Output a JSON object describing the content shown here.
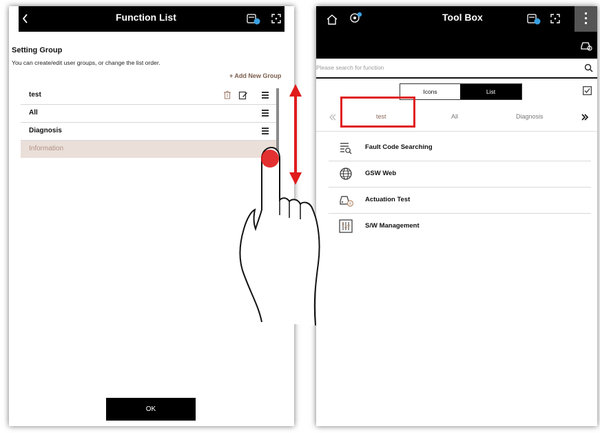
{
  "left": {
    "header_title": "Function List",
    "section_title": "Setting Group",
    "description": "You can create/edit user groups, or change the list order.",
    "add_group_label": "+ Add New Group",
    "groups": [
      {
        "label": "test"
      },
      {
        "label": "All"
      },
      {
        "label": "Diagnosis"
      },
      {
        "label": "Information"
      }
    ],
    "ok_label": "OK"
  },
  "right": {
    "header_title": "Tool Box",
    "search_placeholder": "Please search for function",
    "view_toggle": {
      "icons_label": "Icons",
      "list_label": "List",
      "selected": "List"
    },
    "group_tabs": [
      {
        "label": "test"
      },
      {
        "label": "All"
      },
      {
        "label": "Diagnosis"
      }
    ],
    "functions": [
      {
        "label": "Fault Code Searching",
        "icon": "fault-code-search-icon"
      },
      {
        "label": "GSW Web",
        "icon": "globe-icon"
      },
      {
        "label": "Actuation Test",
        "icon": "car-actuation-icon"
      },
      {
        "label": "S/W Management",
        "icon": "sliders-icon"
      }
    ]
  },
  "colors": {
    "header_bg": "#000000",
    "selected_row_bg": "#eadfd9",
    "selected_row_text": "#b39284",
    "accent_red": "#e01b1b",
    "add_group_text": "#7a5c4c"
  }
}
